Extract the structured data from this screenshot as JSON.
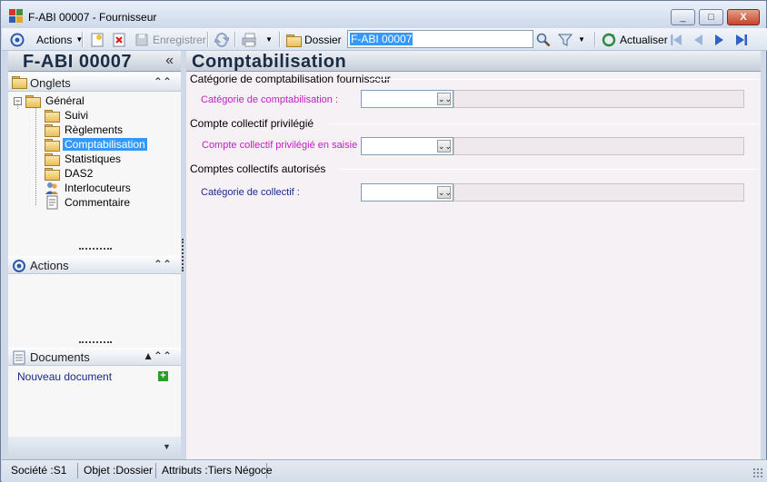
{
  "window": {
    "title": "F-ABI 00007 -  Fournisseur",
    "controls": {
      "minimize": "_",
      "maximize": "□",
      "close": "X"
    }
  },
  "toolbar": {
    "actions_label": "Actions",
    "save_label": "Enregistrer",
    "folder_label": "Dossier",
    "search_value": "F-ABI 00007",
    "refresh_label": "Actualiser"
  },
  "left": {
    "record_code": "F-ABI 00007",
    "collapse_glyph": "«",
    "sections": {
      "tabs": "Onglets",
      "actions": "Actions",
      "documents": "Documents"
    },
    "tree": {
      "root": "Général",
      "items": [
        "Suivi",
        "Règlements",
        "Comptabilisation",
        "Statistiques",
        "DAS2",
        "Interlocuteurs",
        "Commentaire"
      ],
      "selected": "Comptabilisation"
    },
    "new_document": "Nouveau document"
  },
  "main": {
    "title": "Comptabilisation",
    "groups": [
      {
        "title": "Catégorie de comptabilisation fournisseur",
        "field_label": "Catégorie de comptabilisation :",
        "value": "",
        "description": ""
      },
      {
        "title": "Compte collectif privilégié",
        "field_label": "Compte collectif privilégié en saisie :",
        "value": "",
        "description": ""
      },
      {
        "title": "Comptes collectifs autorisés",
        "field_label": "Catégorie de collectif :",
        "value": "",
        "description": ""
      }
    ]
  },
  "status": {
    "company": "Société :S1",
    "object": "Objet :Dossier",
    "attributes": "Attributs :Tiers Négoce"
  },
  "colors": {
    "accent": "#3399ff",
    "mandatory_label": "#c020c0",
    "optional_label": "#1a2a8a",
    "title_blue": "#1a2c44"
  }
}
